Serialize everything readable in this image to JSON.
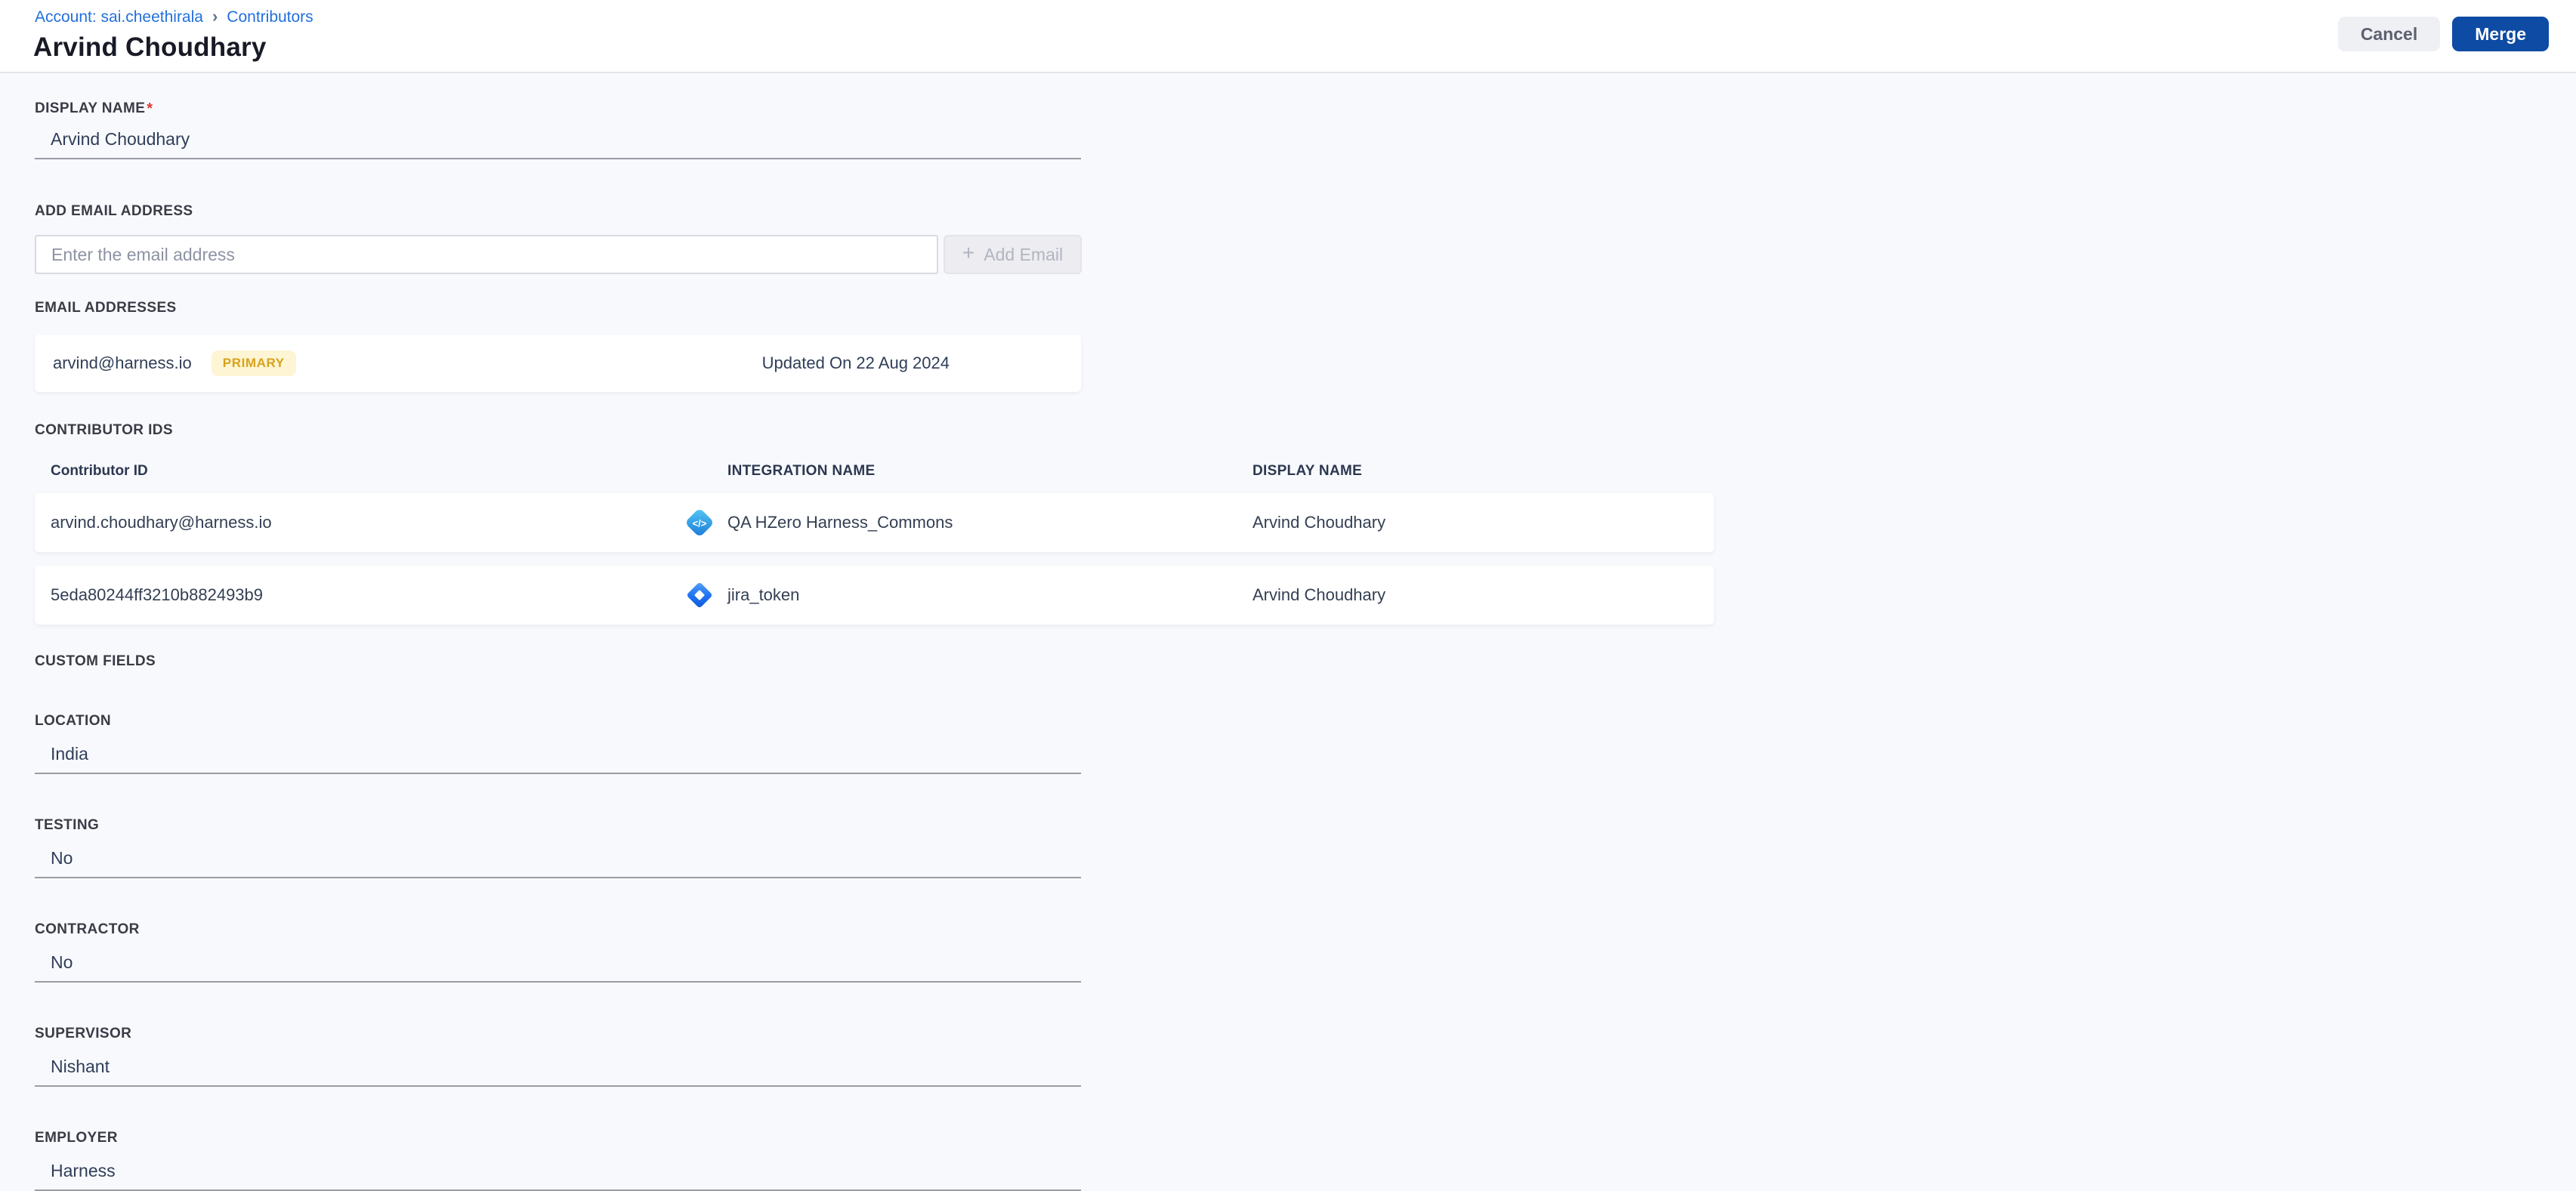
{
  "breadcrumb": {
    "account_link": "Account: sai.cheethirala",
    "separator": "›",
    "current_link": "Contributors"
  },
  "page": {
    "title": "Arvind Choudhary"
  },
  "actions": {
    "cancel_label": "Cancel",
    "merge_label": "Merge"
  },
  "display_name": {
    "label": "DISPLAY NAME",
    "required_marker": "*",
    "value": "Arvind Choudhary"
  },
  "add_email": {
    "label": "ADD EMAIL ADDRESS",
    "placeholder": "Enter the email address",
    "plus_icon": "+",
    "button_label": "Add Email"
  },
  "email_addresses": {
    "label": "EMAIL ADDRESSES",
    "items": [
      {
        "email": "arvind@harness.io",
        "badge": "PRIMARY",
        "updated": "Updated On 22 Aug 2024"
      }
    ]
  },
  "contributor_ids": {
    "label": "CONTRIBUTOR IDS",
    "columns": {
      "id": "Contributor ID",
      "integration": "INTEGRATION NAME",
      "display_name": "DISPLAY NAME"
    },
    "rows": [
      {
        "id": "arvind.choudhary@harness.io",
        "icon": "code-integration-icon",
        "integration": "QA HZero Harness_Commons",
        "display_name": "Arvind Choudhary"
      },
      {
        "id": "5eda80244ff3210b882493b9",
        "icon": "jira-icon",
        "integration": "jira_token",
        "display_name": "Arvind Choudhary"
      }
    ]
  },
  "custom_fields": {
    "label": "CUSTOM FIELDS",
    "fields": [
      {
        "label": "LOCATION",
        "value": "India"
      },
      {
        "label": "TESTING",
        "value": "No"
      },
      {
        "label": "CONTRACTOR",
        "value": "No"
      },
      {
        "label": "SUPERVISOR",
        "value": "Nishant"
      },
      {
        "label": "EMPLOYER",
        "value": "Harness"
      }
    ]
  },
  "colors": {
    "page_background": "#f8f9fd",
    "header_background": "#ffffff",
    "breadcrumb_link": "#2270dd",
    "merge_button": "#0d4ba4",
    "cancel_button_bg": "#eff0f4",
    "primary_badge_bg": "#fdf5d3",
    "primary_badge_text": "#d7a31c",
    "required_star": "#e03a2f",
    "field_underline": "#9b9ba5",
    "value_text": "#2f3e58"
  }
}
